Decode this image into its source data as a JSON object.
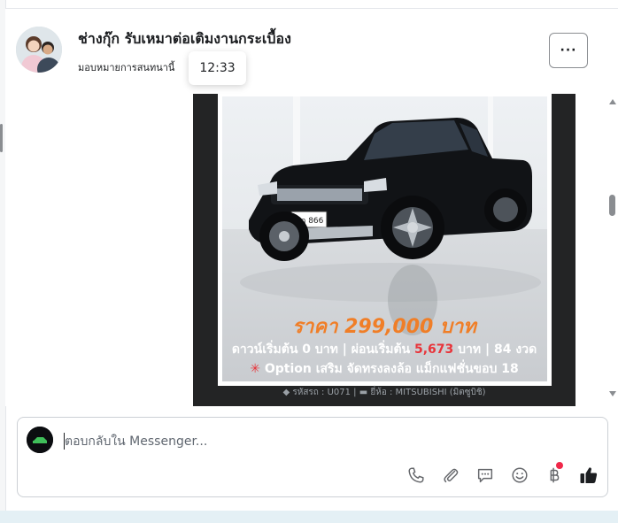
{
  "header": {
    "title": "ช่างกุ๊ก รับเหมาต่อเติมงานกระเบื้อง",
    "subtitle": "มอบหมายการสนทนานี้",
    "more_label": "···",
    "tooltip_time": "12:33"
  },
  "message": {
    "price": "ราคา 299,000 บาท",
    "down_text": "ดาวน์เริ่มต้น 0 บาท | ผ่อนเริ่มต้น ",
    "installment": "5,673",
    "installment_suffix": " บาท | 84 งวด",
    "option_star": "✳",
    "option_text": " Option เสริม จัดทรงลงล้อ แม็กแฟชั่นขอบ 18",
    "meta_code": "รหัสรถ : U071",
    "meta_brand": "ยี่ห้อ : MITSUBISHI (มิตซูบิชิ)",
    "plate": "ฆฎ 866"
  },
  "composer": {
    "placeholder": "ตอบกลับใน Messenger..."
  },
  "toolbar": {
    "icons": [
      "phone-icon",
      "paperclip-icon",
      "chat-bubble-icon",
      "smiley-icon",
      "baht-icon",
      "thumbs-up-icon"
    ]
  },
  "colors": {
    "price_orange": "#f07e27",
    "installment_red": "#e8343a",
    "card_dark": "#232425"
  }
}
